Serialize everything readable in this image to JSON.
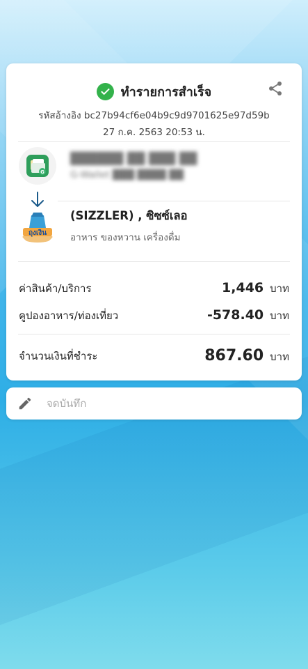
{
  "header": {
    "title": "ทำรายการสำเร็จ",
    "reference": "รหัสอ้างอิง bc27b94cf6e04b9c9d9701625e97d59b",
    "datetime": "27 ก.ค. 2563 20:53 น."
  },
  "sender": {
    "name": "██████ ██ ███ ██",
    "account": "G-Wallet ███ ████ ██"
  },
  "receiver": {
    "name": "(SIZZLER) , ซิซซ์เลอ",
    "category": "อาหาร ของหวาน เครื่องดื่ม"
  },
  "summary": {
    "rows": [
      {
        "label": "ค่าสินค้า/บริการ",
        "amount": "1,446",
        "unit": "บาท"
      },
      {
        "label": "คูปองอาหาร/ท่องเที่ยว",
        "amount": "-578.40",
        "unit": "บาท"
      }
    ],
    "total": {
      "label": "จำนวนเงินที่ชำระ",
      "amount": "867.60",
      "unit": "บาท"
    }
  },
  "note": {
    "placeholder": "จดบันทึก"
  },
  "colors": {
    "success": "#33b24b",
    "arrow": "#1a5a8a"
  }
}
